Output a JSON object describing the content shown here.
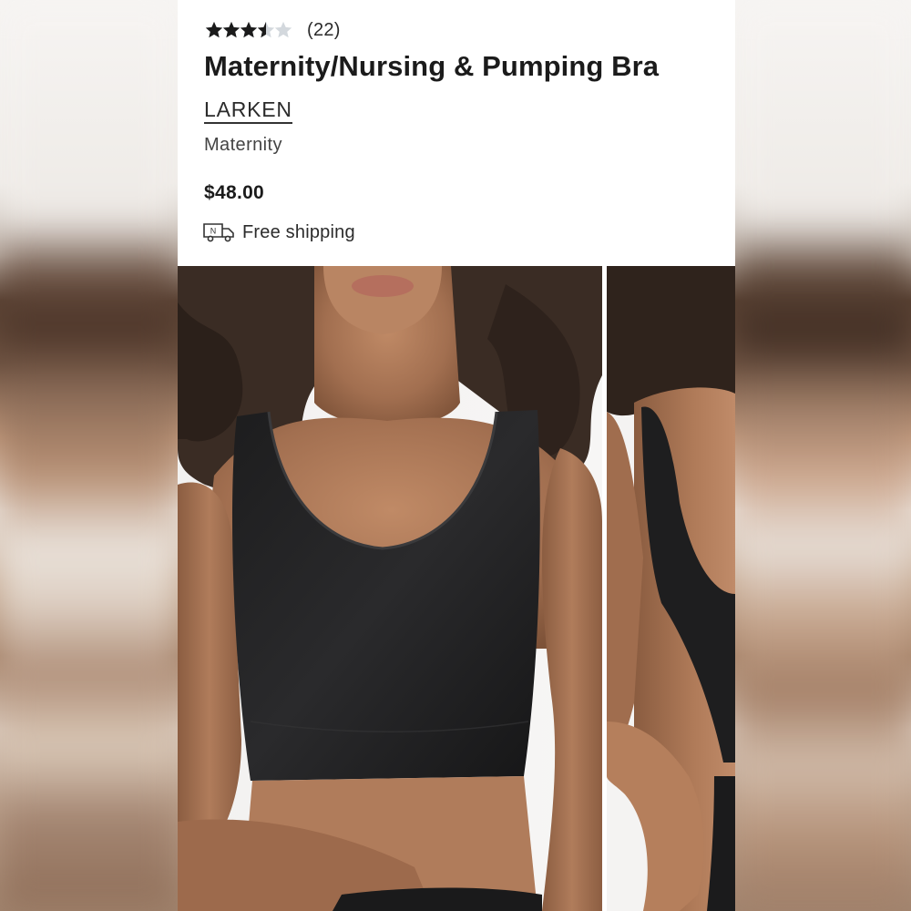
{
  "product": {
    "rating": 3.5,
    "rating_max": 5,
    "review_count": "(22)",
    "title": "Maternity/Nursing & Pumping Bra",
    "brand": "LARKEN",
    "category": "Maternity",
    "price": "$48.00",
    "shipping_label": "Free shipping",
    "shipping_icon": "delivery-truck-icon"
  },
  "images": [
    {
      "name": "product-photo-front"
    },
    {
      "name": "product-photo-side"
    }
  ],
  "colors": {
    "text": "#1b1b1b",
    "star_filled": "#1b1b1b",
    "star_empty": "#d3d8dd",
    "background": "#ffffff"
  }
}
